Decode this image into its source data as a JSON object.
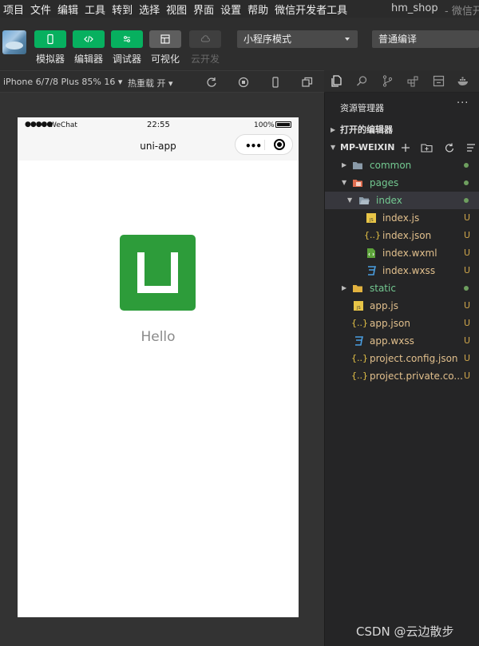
{
  "menu": {
    "items": [
      "项目",
      "文件",
      "编辑",
      "工具",
      "转到",
      "选择",
      "视图",
      "界面",
      "设置",
      "帮助",
      "微信开发者工具"
    ],
    "project_title": "hm_shop",
    "app_title": "- 微信开发"
  },
  "toolbar": {
    "simulator_label": "模拟器",
    "editor_label": "编辑器",
    "debugger_label": "调试器",
    "visual_label": "可视化",
    "cloud_label": "云开发",
    "mode_select": "小程序模式",
    "compile_select": "普通编译"
  },
  "subbar": {
    "device": "iPhone 6/7/8 Plus 85% 16 ▾",
    "hot_reload": "热重载 开 ▾"
  },
  "simulator": {
    "signal": "●●●●●",
    "carrier": "WeChat",
    "time": "22:55",
    "battery_text": "100%",
    "nav_title": "uni-app",
    "capsule_more": "•••",
    "content_text": "Hello"
  },
  "explorer": {
    "title": "资源管理器",
    "more": "···",
    "open_editors": "打开的编辑器",
    "project_root": "MP-WEIXIN",
    "tree": [
      {
        "name": "common",
        "kind": "folder",
        "status": "dot"
      },
      {
        "name": "pages",
        "kind": "folder-open",
        "status": "dot"
      },
      {
        "name": "index",
        "kind": "folder-open",
        "status": "dot"
      },
      {
        "name": "index.js",
        "kind": "js",
        "status": "U"
      },
      {
        "name": "index.json",
        "kind": "json",
        "status": "U"
      },
      {
        "name": "index.wxml",
        "kind": "wxml",
        "status": "U"
      },
      {
        "name": "index.wxss",
        "kind": "wxss",
        "status": "U"
      },
      {
        "name": "static",
        "kind": "folder",
        "status": "dot"
      },
      {
        "name": "app.js",
        "kind": "js",
        "status": "U"
      },
      {
        "name": "app.json",
        "kind": "json",
        "status": "U"
      },
      {
        "name": "app.wxss",
        "kind": "wxss",
        "status": "U"
      },
      {
        "name": "project.config.json",
        "kind": "json",
        "status": "U"
      },
      {
        "name": "project.private.co...",
        "kind": "json",
        "status": "U"
      }
    ]
  },
  "watermark": "CSDN @云边散步",
  "colors": {
    "primary_green": "#07b05f",
    "logo_green": "#2d9c3a",
    "git_untracked": "#cfa64b",
    "tree_added": "#73c991"
  }
}
